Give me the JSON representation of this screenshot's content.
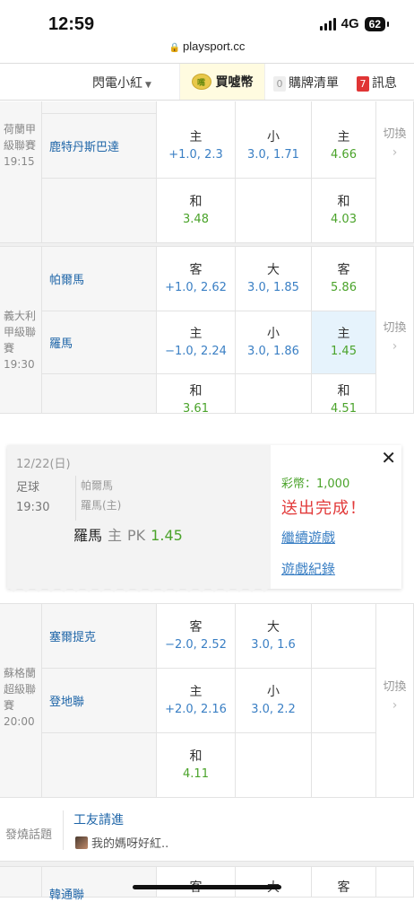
{
  "status": {
    "time": "12:59",
    "network": "4G",
    "battery": "62",
    "url": "playsport.cc"
  },
  "nav": {
    "dropdown": "閃電小紅",
    "coin_icon_text": "嘴",
    "buy": "買噓幣",
    "list_count": "0",
    "list": "購牌清單",
    "msg_count": "7",
    "msg": "訊息"
  },
  "switch_label": "切換",
  "match1": {
    "league": "荷蘭甲級聯賽",
    "time": "19:15",
    "team": "鹿特丹斯巴達",
    "r1": {
      "a_t": "主",
      "a_v": "+1.0, 2.3",
      "b_t": "小",
      "b_v": "3.0, 1.71",
      "c_t": "主",
      "c_v": "4.66"
    },
    "r2": {
      "a_t": "和",
      "a_v": "3.48",
      "c_t": "和",
      "c_v": "4.03"
    }
  },
  "match2": {
    "league": "義大利甲級聯賽",
    "time": "19:30",
    "team_away": "帕爾馬",
    "team_home": "羅馬",
    "r1": {
      "a_t": "客",
      "a_v": "+1.0, 2.62",
      "b_t": "大",
      "b_v": "3.0, 1.85",
      "c_t": "客",
      "c_v": "5.86"
    },
    "r2": {
      "a_t": "主",
      "a_v": "−1.0, 2.24",
      "b_t": "小",
      "b_v": "3.0, 1.86",
      "c_t": "主",
      "c_v": "1.45"
    },
    "r3": {
      "a_t": "和",
      "a_v": "3.61",
      "c_t": "和",
      "c_v": "4.51"
    }
  },
  "popup": {
    "date": "12/22(日)",
    "sport": "足球",
    "time": "19:30",
    "team1": "帕爾馬",
    "team2": "羅馬(主)",
    "pick_team": "羅馬",
    "pick_side": "主",
    "pick_market": "PK",
    "pick_odds": "1.45",
    "coins": "彩幣：1,000",
    "done": "送出完成！",
    "continue": "繼續遊戲",
    "records": "遊戲紀錄",
    "close": "✕"
  },
  "match3": {
    "league": "蘇格蘭超級聯賽",
    "time": "20:00",
    "team_away": "塞爾提克",
    "team_home": "登地聯",
    "r1": {
      "a_t": "客",
      "a_v": "−2.0, 2.52",
      "b_t": "大",
      "b_v": "3.0, 1.6"
    },
    "r2": {
      "a_t": "主",
      "a_v": "+2.0, 2.16",
      "b_t": "小",
      "b_v": "3.0, 2.2"
    },
    "r3": {
      "a_t": "和",
      "a_v": "4.11"
    }
  },
  "hot": {
    "label": "發燒話題",
    "title": "工友請進",
    "sub": "我的媽呀好紅.."
  },
  "match4": {
    "team": "韓通聯",
    "a_t": "客",
    "b_t": "大",
    "c_t": "客"
  }
}
